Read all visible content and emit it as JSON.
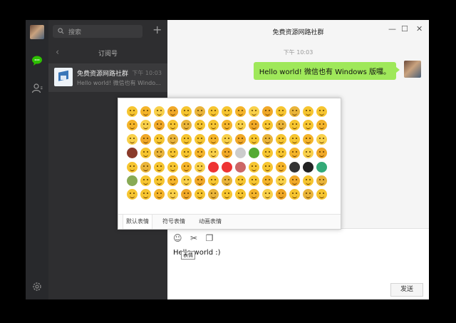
{
  "search": {
    "placeholder": "搜索"
  },
  "list": {
    "header": "订阅号",
    "conversations": [
      {
        "name": "免费资源网路社群",
        "time": "下午 10:03",
        "preview": "Hello world! 微信也有 Windo..."
      }
    ]
  },
  "chat": {
    "title": "免费资源网路社群",
    "timestamp": "下午 10:03",
    "message": "Hello world! 微信也有 Windows 版囉。",
    "input_text": "Hello world :)",
    "tooltip": "表情",
    "send_label": "发送",
    "window_buttons": {
      "minimize": "—",
      "maximize": "☐",
      "close": "✕"
    }
  },
  "emoji_panel": {
    "tabs": [
      "默认表情",
      "符号表情",
      "动画表情"
    ],
    "selected_tab": "默认表情",
    "count": 105
  },
  "colors": {
    "accent_green": "#9fe85a",
    "chat_icon_green": "#2dc100",
    "rail_bg": "#28292c",
    "list_bg": "#2e2e30"
  }
}
